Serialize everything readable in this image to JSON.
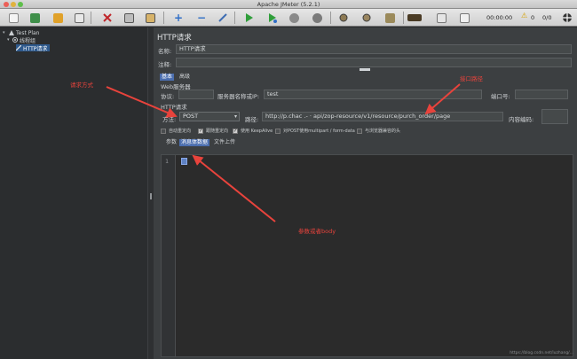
{
  "window": {
    "title": "Apache JMeter (5.2.1)"
  },
  "toolbar": {
    "buttons": [
      "new-icon",
      "templates-icon",
      "open-icon",
      "save-icon",
      "cut-icon",
      "copy-icon",
      "paste-icon",
      "expand-icon",
      "collapse-icon",
      "toggle-icon",
      "start-icon",
      "start-no-pause-icon",
      "stop-icon",
      "shutdown-icon",
      "remote-icon",
      "clear-icon",
      "clear-all-icon",
      "search-icon",
      "reset-search-icon",
      "function-helper-icon",
      "help-icon"
    ],
    "timer": "00:00:00",
    "warnings": "0",
    "threads": "0/0"
  },
  "tree": {
    "nodes": [
      {
        "label": "Test Plan",
        "icon": "test-plan-icon"
      },
      {
        "label": "线程组",
        "icon": "thread-group-icon"
      },
      {
        "label": "HTTP请求",
        "icon": "http-sampler-icon",
        "selected": true
      }
    ]
  },
  "panel": {
    "heading": "HTTP请求",
    "name_label": "名称:",
    "name_value": "HTTP请求",
    "comment_label": "注释:",
    "comment_value": "",
    "tabs": [
      "基本",
      "高级"
    ],
    "web_server_label": "Web服务器",
    "protocol_label": "协议:",
    "protocol_value": "",
    "server_label": "服务器名称或IP:",
    "server_value": "test",
    "port_label": "端口号:",
    "port_value": "",
    "http_request_label": "HTTP请求",
    "method_label": "方法:",
    "method_value": "POST",
    "path_label": "路径:",
    "path_value": "http://p.chac  .- ·  api/zop-resource/v1/resource/purch_order/page",
    "encoding_label": "内容编码:",
    "encoding_value": "",
    "checkboxes": [
      {
        "label": "自动重定向",
        "checked": false
      },
      {
        "label": "跟随重定向",
        "checked": true
      },
      {
        "label": "使用 KeepAlive",
        "checked": true
      },
      {
        "label": "对POST使用multipart / form-data",
        "checked": false
      },
      {
        "label": "与浏览器兼容的头",
        "checked": false
      }
    ],
    "body_tabs": [
      "参数",
      "消息体数据",
      "文件上传"
    ],
    "editor_line": "1"
  },
  "annotations": {
    "method": "请求方式",
    "path": "接口路径",
    "body": "参数或者body"
  },
  "watermark": "https://blog.csdn.net/luzhang/...",
  "colors": {
    "annotation": "#e8433c",
    "selection": "#2f5a8d",
    "panel_bg": "#3c3f41"
  }
}
